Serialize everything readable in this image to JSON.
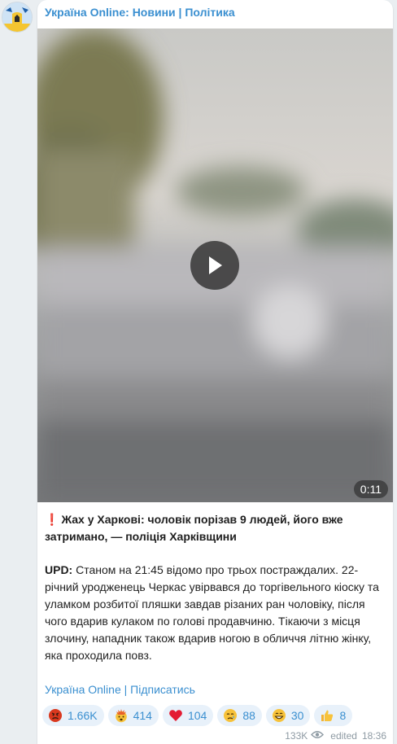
{
  "channel": {
    "title": "Україна Online: Новини | Політика",
    "footer_link": "Україна Online | Підписатись"
  },
  "video": {
    "duration": "0:11"
  },
  "post": {
    "headline_mark": "❗",
    "headline": "Жах у Харкові: чоловік порізав 9 людей, його вже затримано, — поліція Харківщини",
    "upd_label": "UPD:",
    "body": " Станом на 21:45 відомо про трьох постраждалих. 22-річний уродженець Черкас увірвався до торгівельного кіоску та уламком розбитої пляшки завдав різаних ран чоловіку, після чого вдарив кулаком по голові продавчиню. Тікаючи з місця злочину, нападник також вдарив ногою в обличчя літню жінку, яка проходила повз."
  },
  "reactions": [
    {
      "icon": "angry-face-icon",
      "count": "1.66K"
    },
    {
      "icon": "exploding-head-icon",
      "count": "414"
    },
    {
      "icon": "heart-icon",
      "count": "104"
    },
    {
      "icon": "crying-face-icon",
      "count": "88"
    },
    {
      "icon": "grinning-face-icon",
      "count": "30"
    },
    {
      "icon": "thumbs-up-icon",
      "count": "8"
    }
  ],
  "meta": {
    "views": "133K",
    "edited_label": "edited",
    "time": "18:36"
  },
  "colors": {
    "accent": "#3a8fd0",
    "reaction_bg": "#e8f1fa",
    "page_bg": "#eaeef1"
  }
}
